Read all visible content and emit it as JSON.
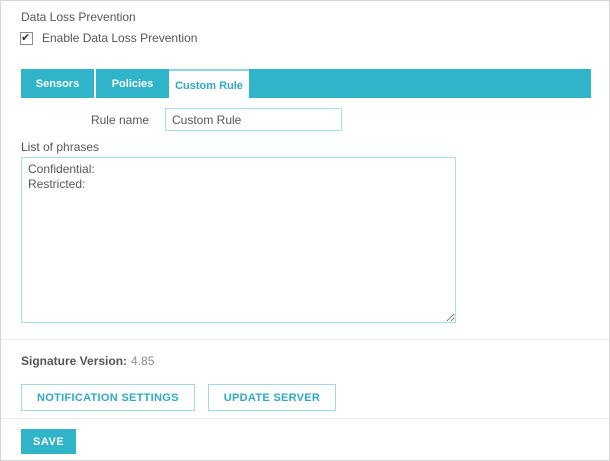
{
  "page": {
    "title": "Data Loss Prevention"
  },
  "enable": {
    "label": "Enable Data Loss Prevention",
    "checked": true
  },
  "tabs": [
    {
      "label": "Sensors",
      "active": false
    },
    {
      "label": "Policies",
      "active": false
    },
    {
      "label": "Custom Rule",
      "active": true
    }
  ],
  "form": {
    "rule_name": {
      "label": "Rule name",
      "value": "Custom Rule"
    },
    "phrases": {
      "label": "List of phrases",
      "value": "Confidential:\nRestricted:"
    }
  },
  "status": {
    "signature_label": "Signature Version:",
    "signature_value": "4.85"
  },
  "buttons": {
    "notification": "NOTIFICATION SETTINGS",
    "update": "UPDATE SERVER",
    "save": "SAVE"
  },
  "colors": {
    "accent": "#2fb4c9",
    "accent_border_light": "#a9dde9",
    "button_text": "#2fa9c4",
    "text": "#575757",
    "frame_border": "#d6d6d6"
  }
}
